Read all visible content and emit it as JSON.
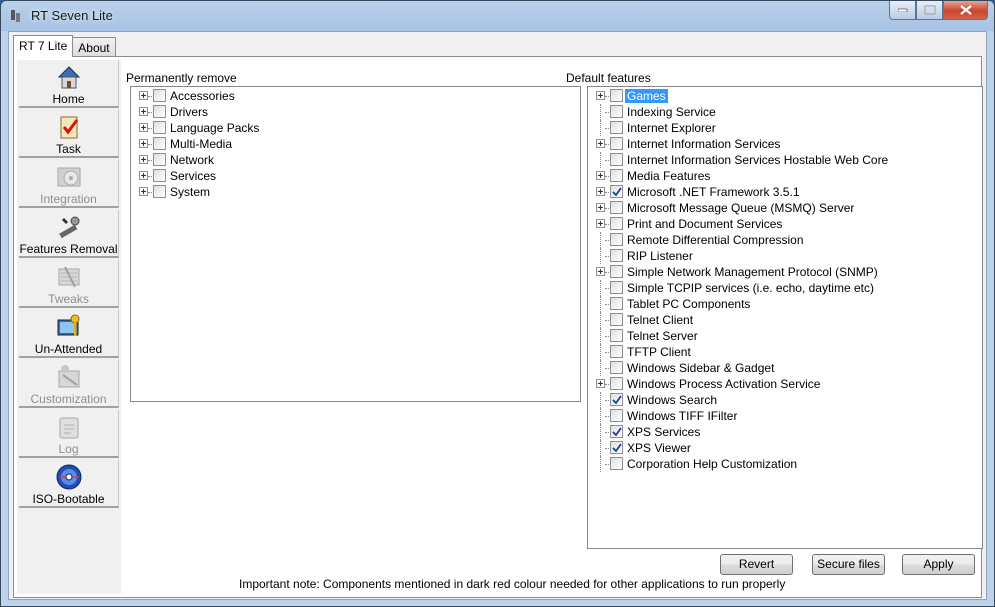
{
  "window": {
    "title": "RT Seven Lite",
    "controls": [
      "minimize",
      "maximize",
      "close"
    ]
  },
  "tabs": [
    {
      "label": "RT 7 Lite",
      "active": true
    },
    {
      "label": "About",
      "active": false
    }
  ],
  "sidebar": {
    "items": [
      {
        "label": "Home",
        "icon": "house-icon",
        "enabled": true
      },
      {
        "label": "Task",
        "icon": "checklist-icon",
        "enabled": true
      },
      {
        "label": "Integration",
        "icon": "integration-disc-icon",
        "enabled": false
      },
      {
        "label": "Features Removal",
        "icon": "tools-icon",
        "enabled": true
      },
      {
        "label": "Tweaks",
        "icon": "tweaks-icon",
        "enabled": false
      },
      {
        "label": "Un-Attended",
        "icon": "key-monitor-icon",
        "enabled": true
      },
      {
        "label": "Customization",
        "icon": "customization-icon",
        "enabled": false
      },
      {
        "label": "Log",
        "icon": "log-icon",
        "enabled": false
      },
      {
        "label": "ISO-Bootable",
        "icon": "disc-icon",
        "enabled": true
      }
    ]
  },
  "permanently_remove": {
    "label": "Permanently remove",
    "items": [
      {
        "label": "Accessories",
        "expandable": true,
        "checked": false
      },
      {
        "label": "Drivers",
        "expandable": true,
        "checked": false
      },
      {
        "label": "Language Packs",
        "expandable": true,
        "checked": false
      },
      {
        "label": "Multi-Media",
        "expandable": true,
        "checked": false
      },
      {
        "label": "Network",
        "expandable": true,
        "checked": false
      },
      {
        "label": "Services",
        "expandable": true,
        "checked": false
      },
      {
        "label": "System",
        "expandable": true,
        "checked": false
      }
    ]
  },
  "default_features": {
    "label": "Default features",
    "items": [
      {
        "label": "Games",
        "expandable": true,
        "checked": false,
        "selected": true
      },
      {
        "label": "Indexing Service",
        "expandable": false,
        "checked": false
      },
      {
        "label": "Internet Explorer",
        "expandable": false,
        "checked": false
      },
      {
        "label": "Internet Information Services",
        "expandable": true,
        "checked": false
      },
      {
        "label": "Internet Information Services Hostable Web Core",
        "expandable": false,
        "checked": false
      },
      {
        "label": "Media Features",
        "expandable": true,
        "checked": false
      },
      {
        "label": "Microsoft .NET Framework 3.5.1",
        "expandable": true,
        "checked": true
      },
      {
        "label": "Microsoft Message Queue (MSMQ) Server",
        "expandable": true,
        "checked": false
      },
      {
        "label": "Print and Document Services",
        "expandable": true,
        "checked": false
      },
      {
        "label": "Remote Differential Compression",
        "expandable": false,
        "checked": false
      },
      {
        "label": "RIP Listener",
        "expandable": false,
        "checked": false
      },
      {
        "label": "Simple Network Management Protocol (SNMP)",
        "expandable": true,
        "checked": false
      },
      {
        "label": "Simple TCPIP services (i.e. echo, daytime etc)",
        "expandable": false,
        "checked": false
      },
      {
        "label": "Tablet PC Components",
        "expandable": false,
        "checked": false
      },
      {
        "label": "Telnet Client",
        "expandable": false,
        "checked": false
      },
      {
        "label": "Telnet Server",
        "expandable": false,
        "checked": false
      },
      {
        "label": "TFTP Client",
        "expandable": false,
        "checked": false
      },
      {
        "label": "Windows Sidebar & Gadget",
        "expandable": false,
        "checked": false
      },
      {
        "label": "Windows Process Activation Service",
        "expandable": true,
        "checked": false
      },
      {
        "label": "Windows Search",
        "expandable": false,
        "checked": true
      },
      {
        "label": "Windows TIFF IFilter",
        "expandable": false,
        "checked": false
      },
      {
        "label": "XPS Services",
        "expandable": false,
        "checked": true
      },
      {
        "label": "XPS Viewer",
        "expandable": false,
        "checked": true
      },
      {
        "label": "Corporation Help Customization",
        "expandable": false,
        "checked": false
      }
    ]
  },
  "buttons": {
    "revert": "Revert",
    "secure_files": "Secure files",
    "apply": "Apply"
  },
  "note": "Important note: Components mentioned in dark red colour needed for other applications to run properly",
  "colors": {
    "selection": "#3399ff",
    "titlebar": "#b9d1ea"
  }
}
